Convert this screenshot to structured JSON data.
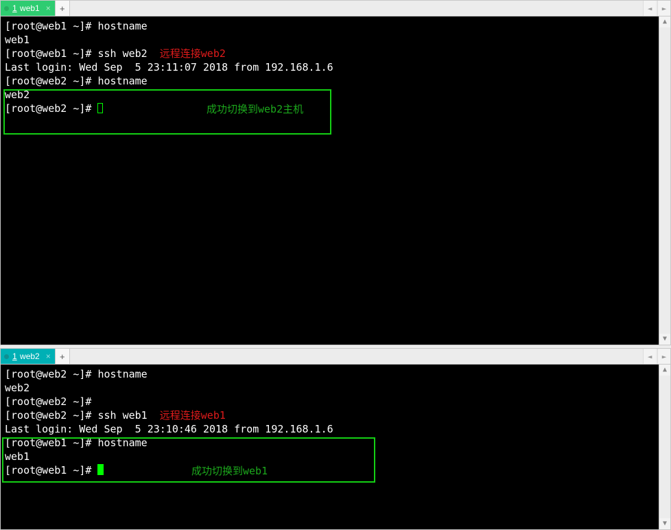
{
  "pane1": {
    "tab": {
      "index": "1",
      "label": "web1"
    },
    "lines": {
      "l1_prompt": "[root@web1 ~]# ",
      "l1_cmd": "hostname",
      "l2": "web1",
      "l3_prompt": "[root@web1 ~]# ",
      "l3_cmd": "ssh web2",
      "l3_note": "远程连接web2",
      "l4": "Last login: Wed Sep  5 23:11:07 2018 from 192.168.1.6",
      "l5_prompt": "[root@web2 ~]# ",
      "l5_cmd": "hostname",
      "l6": "web2",
      "l7_prompt": "[root@web2 ~]# ",
      "box_note": "成功切换到web2主机"
    }
  },
  "pane2": {
    "tab": {
      "index": "1",
      "label": "web2"
    },
    "lines": {
      "l1_prompt": "[root@web2 ~]# ",
      "l1_cmd": "hostname",
      "l2": "web2",
      "l3_prompt": "[root@web2 ~]#",
      "l4_prompt": "[root@web2 ~]# ",
      "l4_cmd": "ssh web1",
      "l4_note": "远程连接web1",
      "l5": "Last login: Wed Sep  5 23:10:46 2018 from 192.168.1.6",
      "l6_prompt": "[root@web1 ~]# ",
      "l6_cmd": "hostname",
      "l7": "web1",
      "l8_prompt": "[root@web1 ~]# ",
      "box_note": "成功切换到web1"
    }
  }
}
